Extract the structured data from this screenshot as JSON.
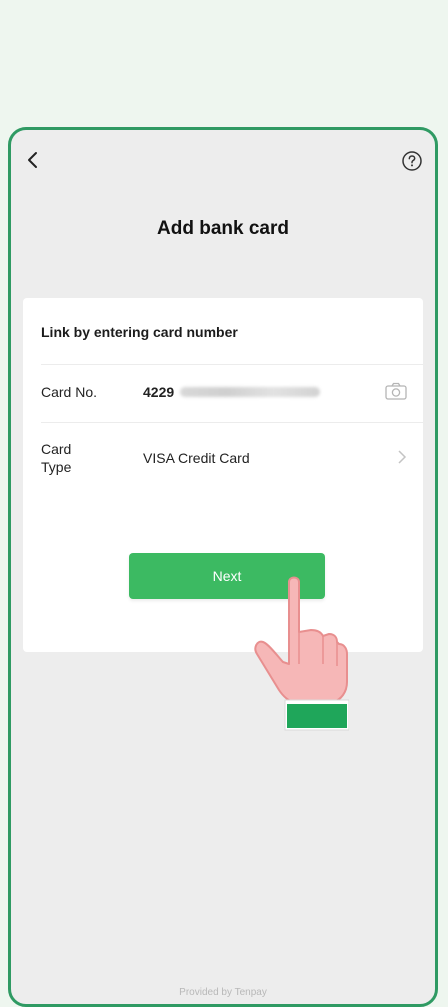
{
  "header": {
    "title": "Add bank card"
  },
  "form": {
    "section_title": "Link by entering card number",
    "card_no_label": "Card No.",
    "card_no_prefix": "4229",
    "card_type_label_line1": "Card",
    "card_type_label_line2": "Type",
    "card_type_value": "VISA Credit Card"
  },
  "actions": {
    "next_label": "Next"
  },
  "footer": {
    "text": "Provided by Tenpay"
  },
  "colors": {
    "accent": "#3cba62",
    "frame": "#2f9a63",
    "background": "#ededed"
  },
  "icons": [
    "back-icon",
    "help-icon",
    "camera-icon",
    "chevron-right-icon",
    "pointing-hand-icon"
  ]
}
